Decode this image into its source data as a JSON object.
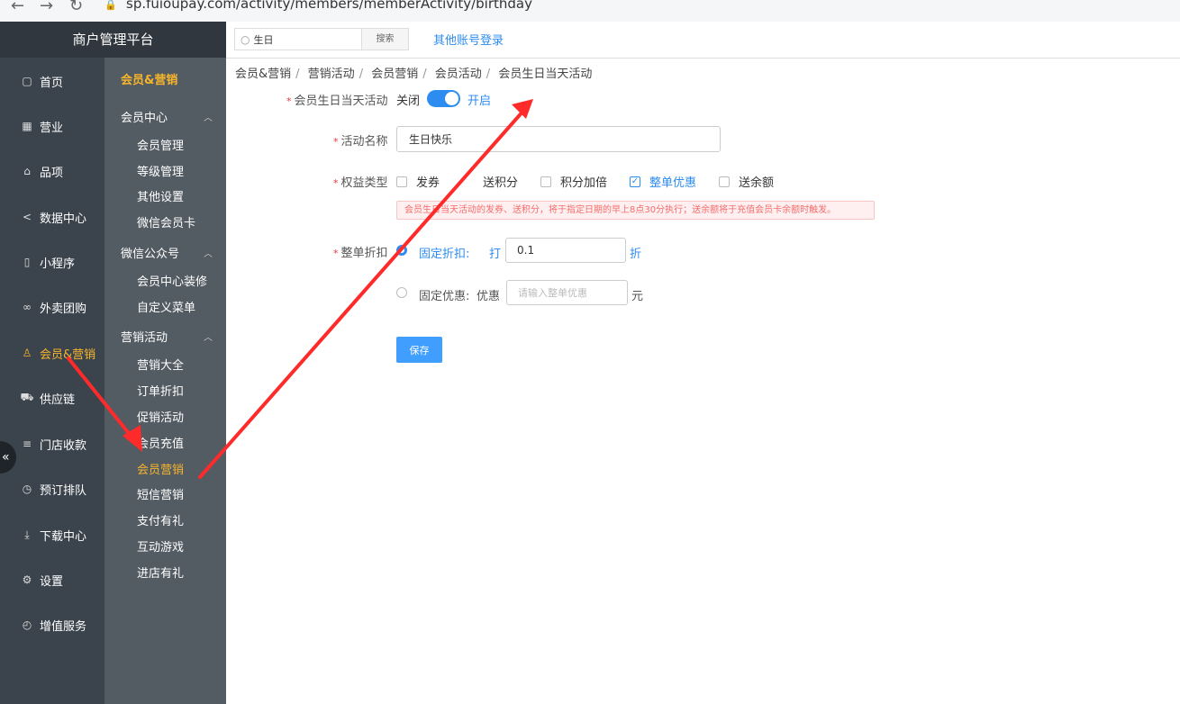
{
  "browser": {
    "url": "sp.fuioupay.com/activity/members/memberActivity/birthday"
  },
  "brand": "商户管理平台",
  "nav": [
    {
      "label": "首页",
      "icon": "home-icon"
    },
    {
      "label": "营业",
      "icon": "calendar-icon"
    },
    {
      "label": "品项",
      "icon": "bag-icon"
    },
    {
      "label": "数据中心",
      "icon": "share-icon"
    },
    {
      "label": "小程序",
      "icon": "phone-icon"
    },
    {
      "label": "外卖团购",
      "icon": "bike-icon"
    },
    {
      "label": "会员&营销",
      "icon": "user-icon"
    },
    {
      "label": "供应链",
      "icon": "truck-icon"
    },
    {
      "label": "门店收款",
      "icon": "database-icon"
    },
    {
      "label": "预订排队",
      "icon": "clock-icon"
    },
    {
      "label": "下载中心",
      "icon": "download-icon"
    },
    {
      "label": "设置",
      "icon": "gear-icon"
    },
    {
      "label": "增值服务",
      "icon": "alarm-icon"
    }
  ],
  "submenu": {
    "title": "会员&营销",
    "groups": [
      {
        "label": "会员中心",
        "items": [
          "会员管理",
          "等级管理",
          "其他设置",
          "微信会员卡"
        ]
      },
      {
        "label": "微信公众号",
        "items": [
          "会员中心装修",
          "自定义菜单"
        ]
      },
      {
        "label": "营销活动",
        "items": [
          "营销大全",
          "订单折扣",
          "促销活动",
          "会员充值",
          "会员营销",
          "短信营销",
          "支付有礼",
          "互动游戏",
          "进店有礼"
        ]
      }
    ]
  },
  "topbar": {
    "search_value": "生日",
    "search_button": "搜索",
    "other_login": "其他账号登录"
  },
  "breadcrumb": [
    "会员&营销",
    "营销活动",
    "会员营销",
    "会员活动",
    "会员生日当天活动"
  ],
  "form": {
    "toggle": {
      "label": "会员生日当天活动",
      "off": "关闭",
      "on": "开启"
    },
    "name": {
      "label": "活动名称",
      "value": "生日快乐"
    },
    "benefit": {
      "label": "权益类型",
      "options": [
        {
          "label": "发券",
          "checked": false
        },
        {
          "label": "送积分",
          "checked": false
        },
        {
          "label": "积分加倍",
          "checked": false
        },
        {
          "label": "整单优惠",
          "checked": true
        },
        {
          "label": "送余额",
          "checked": false
        }
      ],
      "tip": "会员生日当天活动的发券、送积分，将于指定日期的早上8点30分执行；送余额将于充值会员卡余额时触发。"
    },
    "discount": {
      "label": "整单折扣",
      "fixed_discount": {
        "label": "固定折扣:",
        "prefix": "打",
        "value": "0.1",
        "suffix": "折"
      },
      "fixed_amount": {
        "label": "固定优惠:",
        "prefix": "优惠",
        "placeholder": "请输入整单优惠",
        "suffix": "元"
      }
    },
    "save": "保存"
  },
  "colors": {
    "accent": "#2d8cf0",
    "active_menu": "#f7b52c",
    "annotation": "#ff2a2a"
  }
}
